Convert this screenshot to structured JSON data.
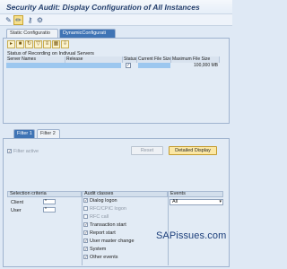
{
  "window": {
    "title": "Security Audit: Display Configuration of All Instances"
  },
  "toolbar": {
    "icons": [
      "display-change-icon",
      "pencil-icon",
      "key-icon",
      "tools-icon"
    ]
  },
  "tabs_upper": [
    {
      "label": "Static Configuratio",
      "active": false
    },
    {
      "label": "DynamicConfigurati",
      "active": true
    }
  ],
  "dynamic": {
    "status_label": "Status of Recording on Indivual Servers",
    "columns": [
      "Server Names",
      "Release",
      "Status",
      "Current File Size",
      "Maximum File Size"
    ],
    "row": {
      "status_checked": true,
      "max_file_size": "100,000 MB"
    }
  },
  "tabs_lower": [
    {
      "label": "Filter 1",
      "active": true
    },
    {
      "label": "Filter 2",
      "active": false
    }
  ],
  "filter": {
    "active_label": "Filter active",
    "reset_label": "Reset",
    "detail_label": "Detailed Display"
  },
  "selection": {
    "header": "Selection criteria",
    "client_label": "Client",
    "client_value": "*",
    "user_label": "User",
    "user_value": "*"
  },
  "audit": {
    "header": "Audit classes",
    "classes": [
      {
        "label": "Dialog logon",
        "checked": true
      },
      {
        "label": "RFC/CPIC logon",
        "checked": false
      },
      {
        "label": "RFC call",
        "checked": false
      },
      {
        "label": "Transaction start",
        "checked": true
      },
      {
        "label": "Report start",
        "checked": true
      },
      {
        "label": "User master change",
        "checked": true
      },
      {
        "label": "System",
        "checked": true
      },
      {
        "label": "Other events",
        "checked": true
      }
    ]
  },
  "events": {
    "header": "Events",
    "selected": "All"
  },
  "watermark": "SAPissues.com",
  "colors": {
    "accent": "#3f74b5",
    "selected_row": "#9cc7ef",
    "title": "#233e6b"
  }
}
